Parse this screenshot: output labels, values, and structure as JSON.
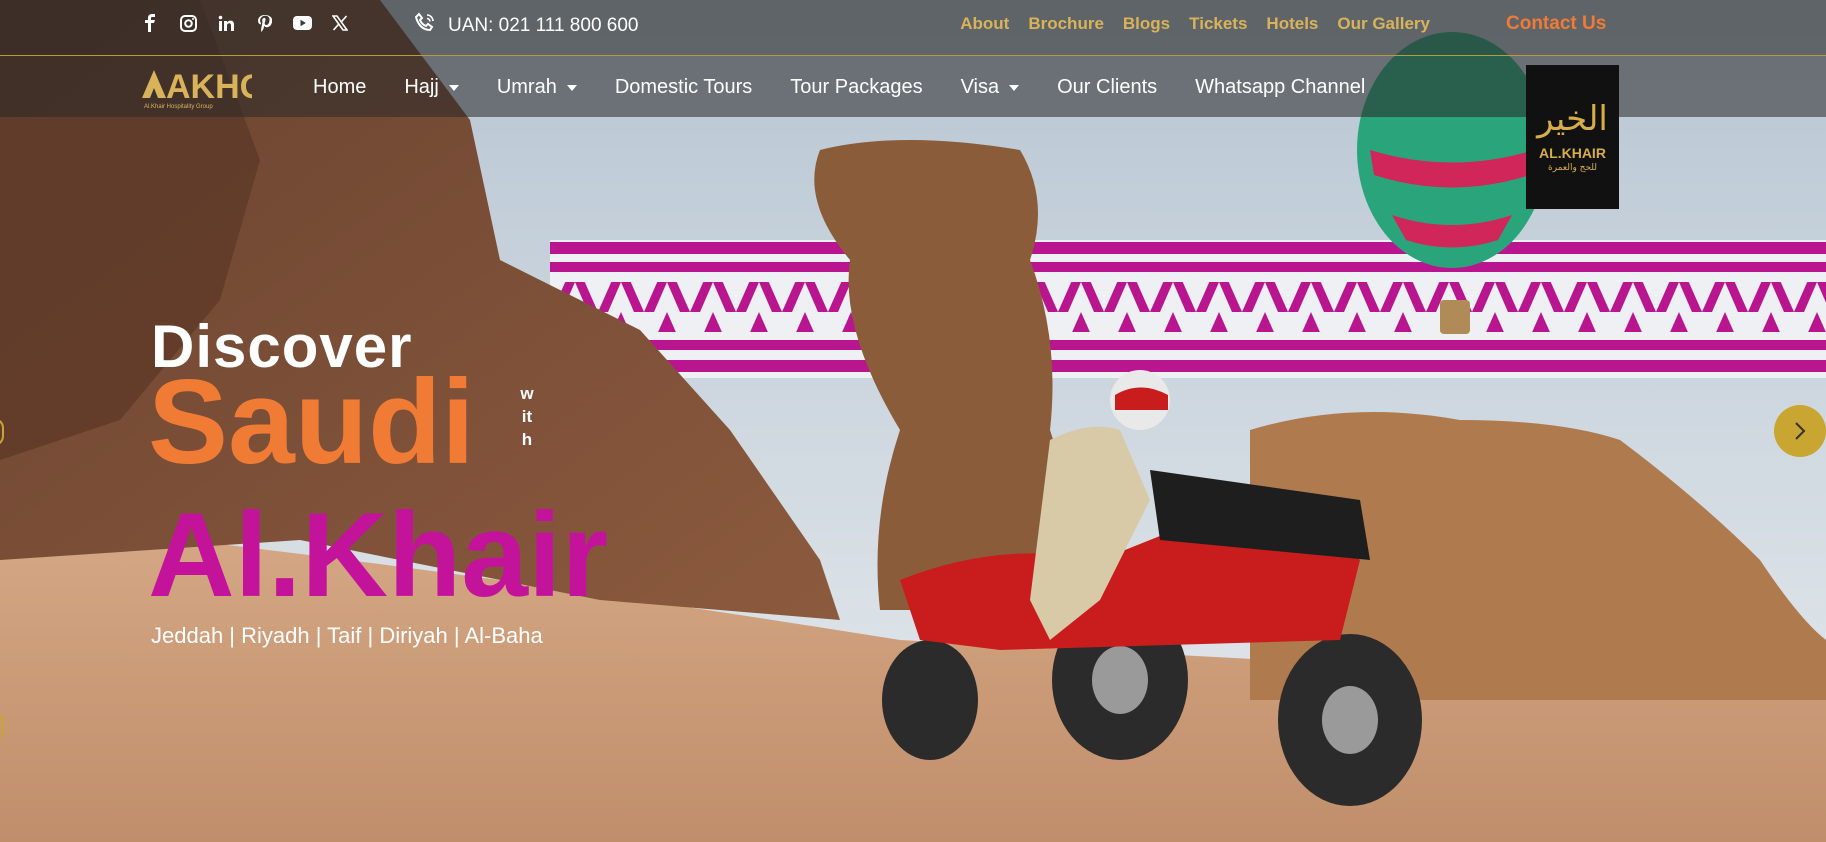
{
  "top_bar": {
    "social_icons": [
      "facebook-icon",
      "instagram-icon",
      "linkedin-icon",
      "pinterest-icon",
      "youtube-icon",
      "x-icon"
    ],
    "uan_text": "UAN: 021 111 800 600",
    "links": [
      "About",
      "Brochure",
      "Blogs",
      "Tickets",
      "Hotels",
      "Our Gallery"
    ],
    "contact_label": "Contact Us"
  },
  "brand": {
    "logo_text": "AKHG",
    "logo_sub": "Al.Khair Hospitality Group",
    "badge_line1": "الخير",
    "badge_line2": "AL.KHAIR",
    "badge_line3": "للحج والعمرة"
  },
  "nav": {
    "items": [
      {
        "label": "Home",
        "dropdown": false
      },
      {
        "label": "Hajj",
        "dropdown": true
      },
      {
        "label": "Umrah",
        "dropdown": true
      },
      {
        "label": "Domestic Tours",
        "dropdown": false
      },
      {
        "label": "Tour Packages",
        "dropdown": false
      },
      {
        "label": "Visa",
        "dropdown": true
      },
      {
        "label": "Our Clients",
        "dropdown": false
      },
      {
        "label": "Whatsapp Channel",
        "dropdown": false
      }
    ]
  },
  "hero": {
    "line1": "Discover",
    "line2": "Saudi",
    "with": "with",
    "line3": "Al.Khair",
    "cities": "Jeddah | Riyadh | Taif | Diriyah | Al-Baha"
  },
  "colors": {
    "accent_gold": "#d8b35a",
    "accent_orange": "#f07b35",
    "accent_magenta": "#c4139b"
  }
}
